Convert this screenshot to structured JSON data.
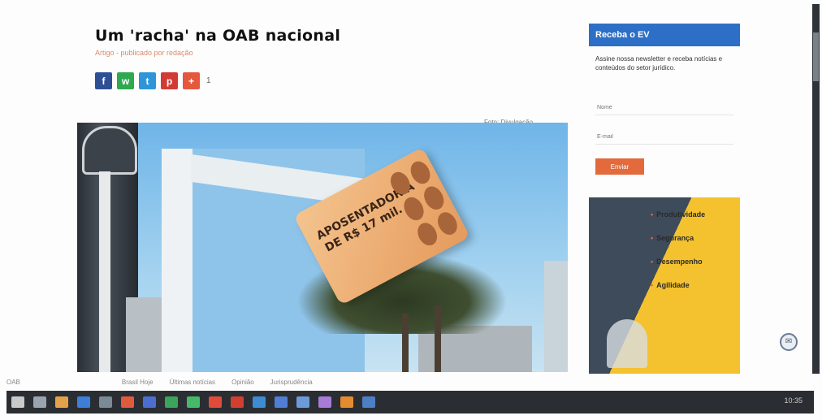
{
  "article": {
    "title": "Um 'racha' na OAB nacional",
    "subtitle": "Artigo - publicado por redação",
    "share_count": "1",
    "image_caption": "Foto: Divulgação"
  },
  "hero": {
    "brick_text": "APOSENTADORIA DE R$ 17 mil."
  },
  "sidebar": {
    "header": "Receba o EV",
    "description": "Assine nossa newsletter e receba notícias e conteúdos do setor jurídico.",
    "name_placeholder": "Nome",
    "email_placeholder": "E-mail",
    "submit_label": "Enviar",
    "ad_items": [
      "Produtividade",
      "Segurança",
      "Desempenho",
      "Agilidade"
    ]
  },
  "share_buttons": [
    {
      "name": "facebook-share-button",
      "glyph": "f"
    },
    {
      "name": "whatsapp-share-button",
      "glyph": "w"
    },
    {
      "name": "twitter-share-button",
      "glyph": "t"
    },
    {
      "name": "pinterest-share-button",
      "glyph": "p"
    },
    {
      "name": "googleplus-share-button",
      "glyph": "+"
    }
  ],
  "status_bar": {
    "left": "OAB",
    "links": [
      "Brasil Hoje",
      "Últimas notícias",
      "Opinião",
      "Jurisprudência"
    ]
  },
  "taskbar": {
    "icon_colors": [
      "#c9c9c9",
      "#9aa4ae",
      "#e3a24a",
      "#3d7fd8",
      "#7c8a95",
      "#e05b3c",
      "#4a6fd1",
      "#3aa45a",
      "#45b86a",
      "#e04b3a",
      "#d23f2f",
      "#3d8bd3",
      "#4f7ed6",
      "#6b9ad9",
      "#a77bd6",
      "#e58b2f",
      "#4d7fc4"
    ],
    "tray_text": "10:35"
  }
}
